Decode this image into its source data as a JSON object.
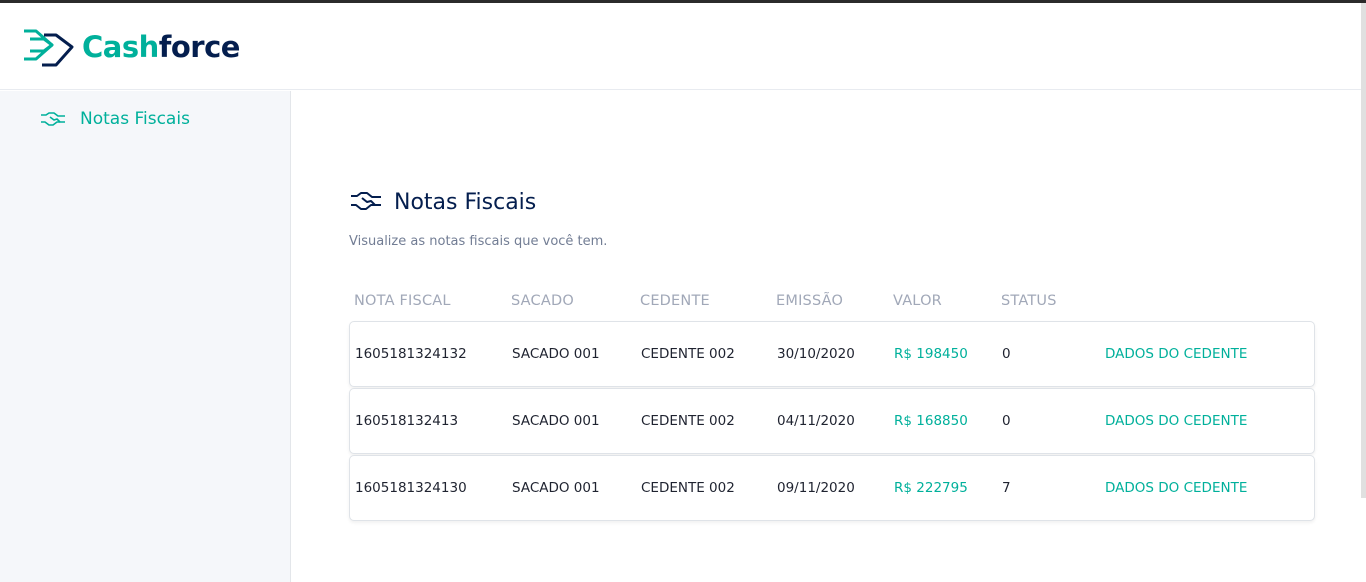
{
  "brand": {
    "part1": "Cash",
    "part2": "force",
    "accent": "#00b09b",
    "dark": "#041e4e"
  },
  "sidebar": {
    "items": [
      {
        "label": "Notas Fiscais",
        "icon": "handshake-icon"
      }
    ]
  },
  "page": {
    "title": "Notas Fiscais",
    "subtitle": "Visualize as notas fiscais que você tem."
  },
  "table": {
    "headers": [
      "NOTA FISCAL",
      "SACADO",
      "CEDENTE",
      "EMISSÃO",
      "VALOR",
      "STATUS"
    ],
    "rows": [
      {
        "nota": "1605181324132",
        "sacado": "SACADO 001",
        "cedente": "CEDENTE 002",
        "emissao": "30/10/2020",
        "valor": "R$ 198450",
        "status": "0",
        "action": "DADOS DO CEDENTE"
      },
      {
        "nota": "160518132413",
        "sacado": "SACADO 001",
        "cedente": "CEDENTE 002",
        "emissao": "04/11/2020",
        "valor": "R$ 168850",
        "status": "0",
        "action": "DADOS DO CEDENTE"
      },
      {
        "nota": "1605181324130",
        "sacado": "SACADO 001",
        "cedente": "CEDENTE 002",
        "emissao": "09/11/2020",
        "valor": "R$ 222795",
        "status": "7",
        "action": "DADOS DO CEDENTE"
      }
    ]
  }
}
